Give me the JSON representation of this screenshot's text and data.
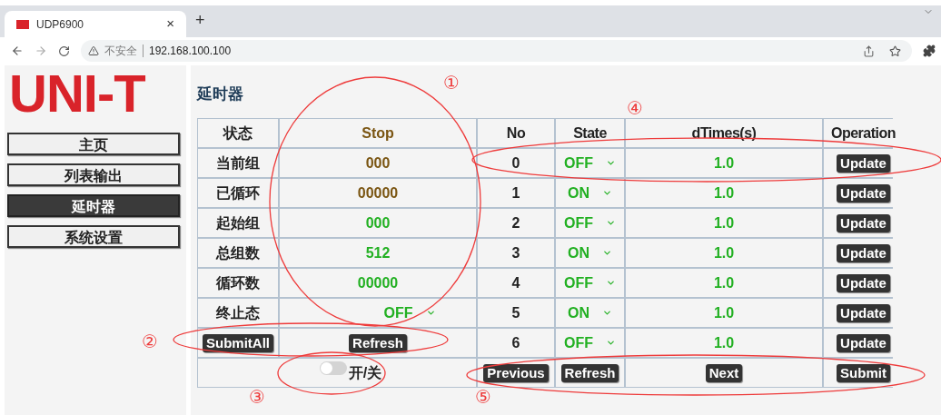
{
  "browser": {
    "tab_title": "UDP6900",
    "tab_close": "×",
    "new_tab": "+",
    "security_label": "不安全",
    "url": "192.168.100.100"
  },
  "logo": "UNI-T",
  "sidebar": {
    "items": [
      {
        "label": "主页",
        "selected": false
      },
      {
        "label": "列表输出",
        "selected": false
      },
      {
        "label": "延时器",
        "selected": true
      },
      {
        "label": "系统设置",
        "selected": false
      }
    ]
  },
  "page_title": "延时器",
  "status_panel": {
    "header": {
      "label": "状态",
      "value": "Stop",
      "color": "#7a5512"
    },
    "rows": [
      {
        "label": "当前组",
        "value": "000",
        "color": "#7a5512",
        "kind": "text"
      },
      {
        "label": "已循环",
        "value": "00000",
        "color": "#7a5512",
        "kind": "text"
      },
      {
        "label": "起始组",
        "value": "000",
        "color": "#22b022",
        "kind": "text"
      },
      {
        "label": "总组数",
        "value": "512",
        "color": "#22b022",
        "kind": "text"
      },
      {
        "label": "循环数",
        "value": "00000",
        "color": "#22b022",
        "kind": "text"
      },
      {
        "label": "终止态",
        "value": "OFF",
        "color": "#22b022",
        "kind": "select"
      }
    ],
    "buttons": [
      "SubmitAll",
      "Refresh"
    ],
    "toggle": {
      "label": "开/关",
      "on": false
    }
  },
  "delay_table": {
    "columns": [
      "No",
      "State",
      "dTimes(s)",
      "Operation"
    ],
    "rows": [
      {
        "no": "0",
        "state": "OFF",
        "dtime": "1.0",
        "action": "Update"
      },
      {
        "no": "1",
        "state": "ON",
        "dtime": "1.0",
        "action": "Update"
      },
      {
        "no": "2",
        "state": "OFF",
        "dtime": "1.0",
        "action": "Update"
      },
      {
        "no": "3",
        "state": "ON",
        "dtime": "1.0",
        "action": "Update"
      },
      {
        "no": "4",
        "state": "OFF",
        "dtime": "1.0",
        "action": "Update"
      },
      {
        "no": "5",
        "state": "ON",
        "dtime": "1.0",
        "action": "Update"
      },
      {
        "no": "6",
        "state": "OFF",
        "dtime": "1.0",
        "action": "Update"
      }
    ],
    "footer_buttons": [
      "Previous",
      "Refresh",
      "Next",
      "Submit"
    ]
  },
  "annotations": [
    "①",
    "②",
    "③",
    "④",
    "⑤"
  ]
}
